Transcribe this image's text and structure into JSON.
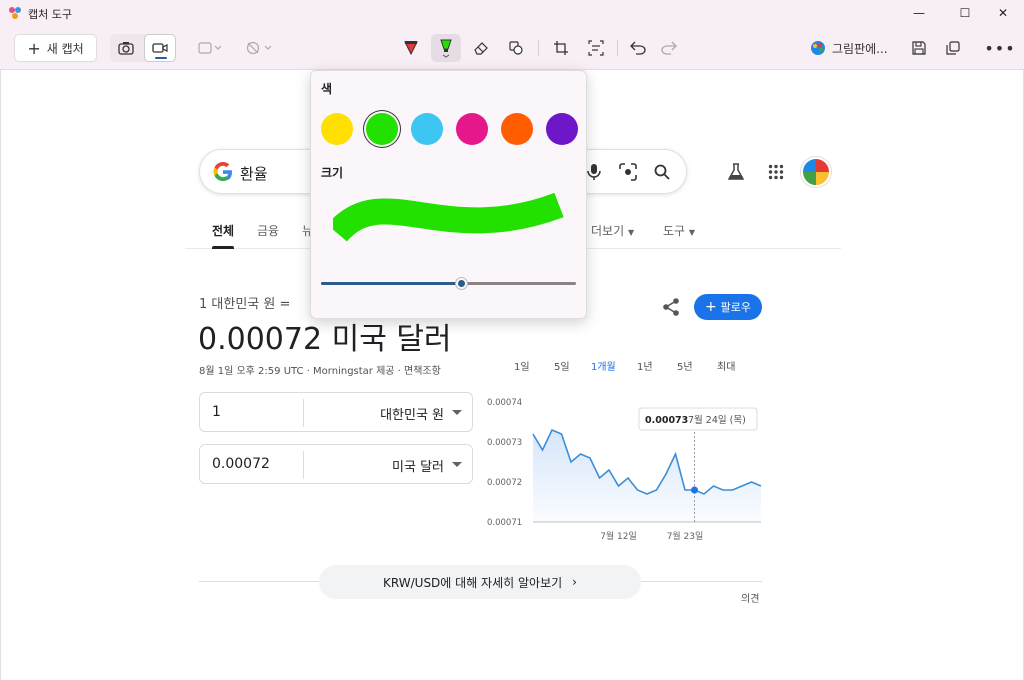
{
  "window": {
    "title": "캡처 도구"
  },
  "toolbar": {
    "new_capture": "새 캡처",
    "open_with": "그림판에..."
  },
  "google": {
    "search_query": "환율",
    "tabs": [
      "전체",
      "금융",
      "뉴",
      "더보기",
      "도구"
    ]
  },
  "currency": {
    "from_label": "1 대한민국 원 =",
    "rate": "0.00072 미국 달러",
    "meta": "8월 1일 오후 2:59 UTC · Morningstar 제공 · 면책조항",
    "follow": "팔로우",
    "input1_value": "1",
    "input1_currency": "대한민국 원",
    "input2_value": "0.00072",
    "input2_currency": "미국 달러",
    "ranges": [
      "1일",
      "5일",
      "1개월",
      "1년",
      "5년",
      "최대"
    ],
    "active_range": "1개월",
    "learn_more": "KRW/USD에 대해 자세히 알아보기",
    "feedback": "의견"
  },
  "popover": {
    "color_title": "색",
    "size_title": "크기",
    "colors": [
      "#ffe000",
      "#22e000",
      "#3ec6f3",
      "#e6178a",
      "#ff5d00",
      "#6e17c9"
    ],
    "selected_color": "#22e000",
    "size_value": 0.55
  },
  "chart_data": {
    "type": "line",
    "y_tick_labels": [
      "0.00074",
      "0.00073",
      "0.00072",
      "0.00071"
    ],
    "x_tick_labels": [
      "7월 12일",
      "7월 23일"
    ],
    "ylim": [
      0.00071,
      0.00074
    ],
    "series": [
      {
        "values": [
          0.000732,
          0.000728,
          0.000733,
          0.000732,
          0.000725,
          0.000727,
          0.000726,
          0.000721,
          0.000723,
          0.000719,
          0.000721,
          0.000718,
          0.000717,
          0.000718,
          0.000722,
          0.000727,
          0.000718,
          0.000718,
          0.000717,
          0.000719,
          0.000718,
          0.000718,
          0.000719,
          0.00072,
          0.000719
        ]
      }
    ],
    "tooltip": {
      "value": "0.00073",
      "date": "7월 24일 (목)"
    }
  }
}
